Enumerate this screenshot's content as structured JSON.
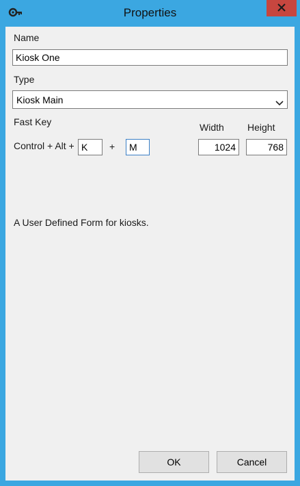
{
  "window": {
    "title": "Properties"
  },
  "form": {
    "name_label": "Name",
    "name_value": "Kiosk One",
    "type_label": "Type",
    "type_value": "Kiosk Main",
    "fast_key_label": "Fast Key",
    "modifier_text": "Control + Alt +",
    "key1_value": "K",
    "plus_text": "+",
    "key2_value": "M",
    "width_label": "Width",
    "width_value": "1024",
    "height_label": "Height",
    "height_value": "768",
    "description": "A User Defined Form for kiosks."
  },
  "buttons": {
    "ok_label": "OK",
    "cancel_label": "Cancel"
  },
  "colors": {
    "border_accent": "#3ba7e1",
    "close_button": "#c7463f",
    "focus_border": "#3a7fc6"
  },
  "icons": {
    "app": "key-gear-icon",
    "close": "close-icon",
    "dropdown": "chevron-down-icon"
  }
}
